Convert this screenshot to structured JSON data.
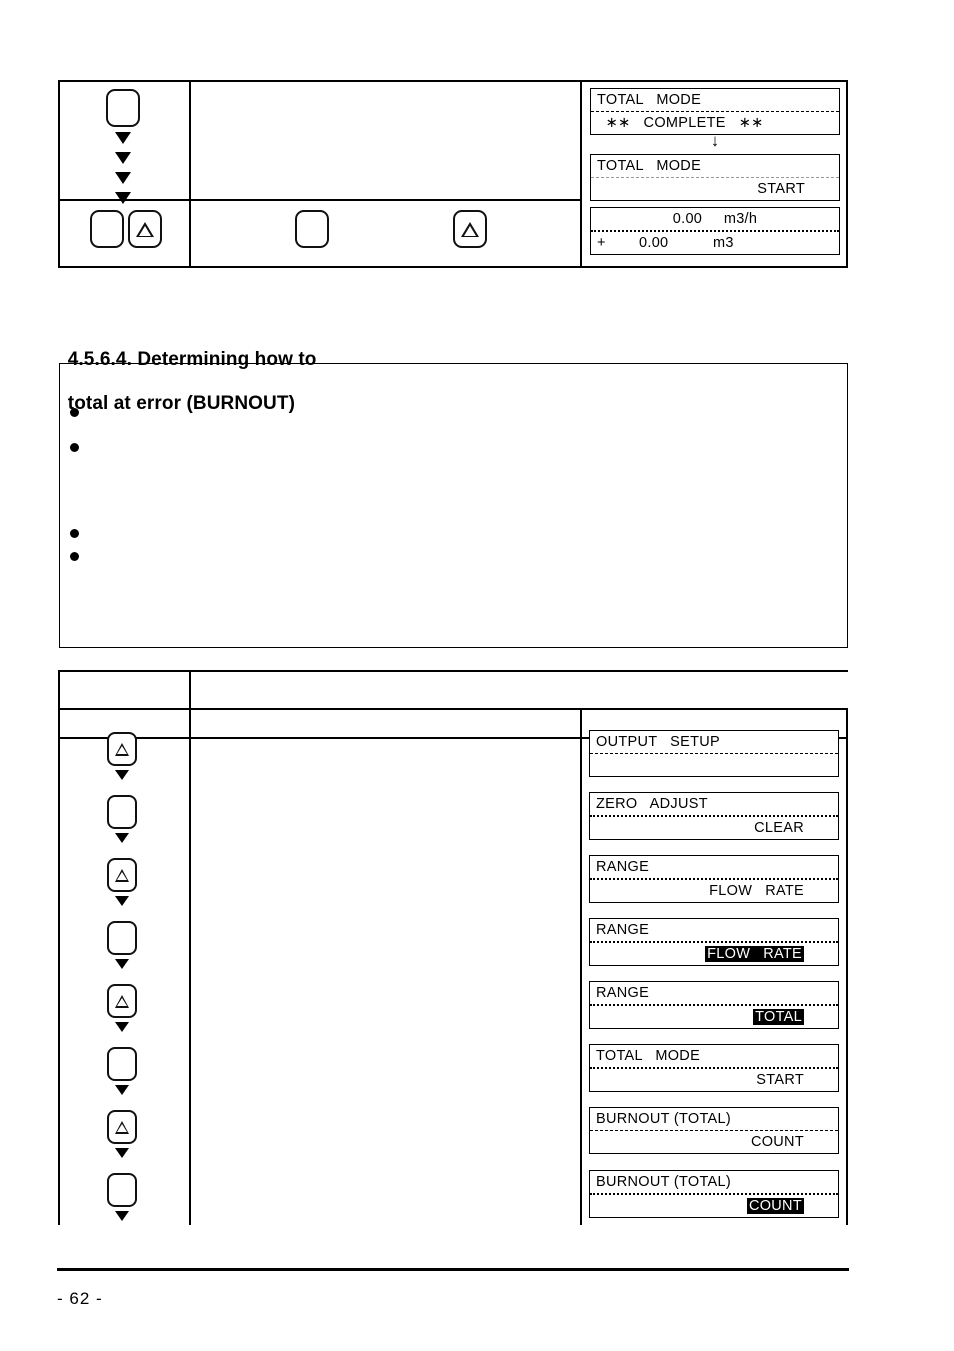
{
  "page": {
    "number_label": "- 62 -"
  },
  "section": {
    "heading_left": "4.5.6.4. Determining how to",
    "heading_right": "total at error (BURNOUT)"
  },
  "top_table": {
    "key_col": {
      "top_key": {
        "icon": "blank-key-icon",
        "label": ""
      },
      "arrow_count": 4,
      "bottom_keys": [
        {
          "icon": "blank-key-icon",
          "label": ""
        },
        {
          "icon": "triangle-key-icon",
          "label": ""
        }
      ]
    },
    "middle_col": {
      "keys": [
        {
          "icon": "blank-key-icon",
          "label": ""
        },
        {
          "icon": "triangle-key-icon",
          "label": ""
        }
      ]
    },
    "display_col": {
      "panels": [
        {
          "line1": "TOTAL   MODE",
          "line2": "  ∗∗   COMPLETE   ∗∗",
          "line2_align": "left",
          "line2_inverted": false
        },
        {
          "line1": "TOTAL   MODE",
          "line2": "START",
          "line2_align": "right",
          "line2_inverted": false
        }
      ],
      "transition_arrow": "↓",
      "readout": {
        "line1": "0.00     m3/h",
        "line2_sign": "+",
        "line2_value": "0.00",
        "line2_unit": "m3"
      }
    }
  },
  "notes_box": {
    "bullets": [
      {
        "text": ""
      },
      {
        "text": ""
      },
      {
        "text": ""
      },
      {
        "text": ""
      }
    ]
  },
  "bottom_table": {
    "headers": {
      "col1": "",
      "col2": "",
      "col3": ""
    },
    "steps": [
      {
        "key_icon": "triangle-key-icon",
        "panel": {
          "line1": "OUTPUT   SETUP",
          "line2": "",
          "line2_align": "left",
          "line2_inverted": false
        }
      },
      {
        "key_icon": "blank-key-icon",
        "panel": {
          "line1": "ZERO   ADJUST",
          "line2": "CLEAR",
          "line2_align": "right",
          "line2_inverted": false
        }
      },
      {
        "key_icon": "triangle-key-icon",
        "panel": {
          "line1": "RANGE",
          "line2": "FLOW   RATE",
          "line2_align": "right",
          "line2_inverted": false
        }
      },
      {
        "key_icon": "blank-key-icon",
        "panel": {
          "line1": "RANGE",
          "line2": "FLOW   RATE",
          "line2_align": "right",
          "line2_inverted": true
        }
      },
      {
        "key_icon": "triangle-key-icon",
        "panel": {
          "line1": "RANGE",
          "line2": "TOTAL",
          "line2_align": "right",
          "line2_inverted": true
        }
      },
      {
        "key_icon": "blank-key-icon",
        "panel": {
          "line1": "TOTAL   MODE",
          "line2": "START",
          "line2_align": "right",
          "line2_inverted": false
        }
      },
      {
        "key_icon": "triangle-key-icon",
        "panel": {
          "line1": "BURNOUT (TOTAL)",
          "line2": "COUNT",
          "line2_align": "right",
          "line2_inverted": false
        }
      },
      {
        "key_icon": "blank-key-icon",
        "panel": {
          "line1": "BURNOUT (TOTAL)",
          "line2": "COUNT",
          "line2_align": "right",
          "line2_inverted": true
        }
      }
    ]
  }
}
